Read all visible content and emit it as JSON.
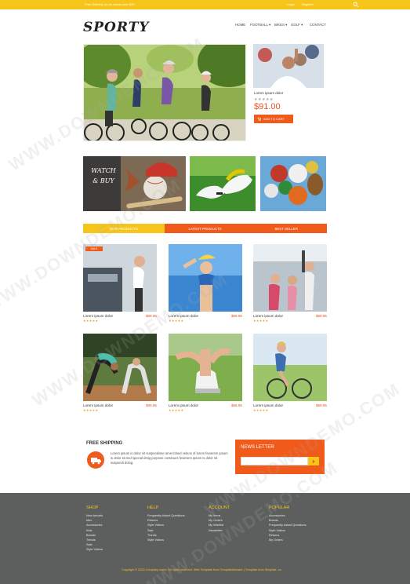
{
  "topbar": {
    "welcome": "Free Delivery on all orders over $20",
    "login": "Login",
    "register": "Register"
  },
  "logo": "SPORTY",
  "nav": [
    "HOME",
    "FOOTBALL ▾",
    "BIKES ▾",
    "GOLF ▾",
    "CONTACT"
  ],
  "featured": {
    "name": "Lorem ipsum dolor",
    "stars": "★★★★★",
    "price": "$91.00",
    "add_to_cart": "ADD TO CART"
  },
  "promo": {
    "watch_buy": "WATCH & BUY"
  },
  "tabs": [
    "NEW PRODUCTS",
    "LATEST PRODUCTS",
    "BEST SELLER"
  ],
  "products": [
    {
      "name": "Lorem ipsum dolor",
      "price": "$59.95",
      "stars": "★★★★★",
      "sale": "SALE"
    },
    {
      "name": "Lorem ipsum dolor",
      "price": "$59.95",
      "stars": "★★★★★"
    },
    {
      "name": "Lorem ipsum dolor",
      "price": "$59.95",
      "stars": "★★★★★"
    },
    {
      "name": "Lorem ipsum dolor",
      "price": "$59.95",
      "stars": "★★★★★"
    },
    {
      "name": "Lorem ipsum dolor",
      "price": "$59.95",
      "stars": "★★★★★"
    },
    {
      "name": "Lorem ipsum dolor",
      "price": "$59.95",
      "stars": "★★★★★"
    }
  ],
  "shipping": {
    "title": "FREE SHIPPING",
    "text": "Lorem ipsum is dolor sit suspendisse amet lobed veleos of lorem fewerem ipsum is dolor sit sed special dmig porpose continues fewerem ipsum is dolor sit suspendi dolog."
  },
  "newsletter": {
    "title": "NEWS LETTER",
    "placeholder": ""
  },
  "footer": {
    "columns": [
      {
        "title": "SHOP",
        "items": [
          "New Arrivals",
          "Men",
          "Accessories",
          "Kids",
          "Brands",
          "Trends",
          "Sale",
          "Style Videos"
        ]
      },
      {
        "title": "HELP",
        "items": [
          "Frequently Asked Questions",
          "Returns",
          "Style Videos",
          "Sale",
          "Trends",
          "Style Videos"
        ]
      },
      {
        "title": "ACCOUNT",
        "items": [
          "My Items",
          "My Orders",
          "My Wishlist",
          "Newsletter"
        ]
      },
      {
        "title": "POPULAR",
        "items": [
          "Accessories",
          "Brands",
          "Frequently Asked Questions",
          "Style Videos",
          "Returns",
          "My Orders"
        ]
      }
    ],
    "copyright": "Copyright © 2015 Company name. All rights reserved. Web Template from TemplateMonster | Template from Simplate .co"
  },
  "watermark": "WWW.DOWNDEMO.COM",
  "colors": {
    "accent": "#f05a1a",
    "yellow": "#f7c51a",
    "footer": "#5d5f5e"
  }
}
